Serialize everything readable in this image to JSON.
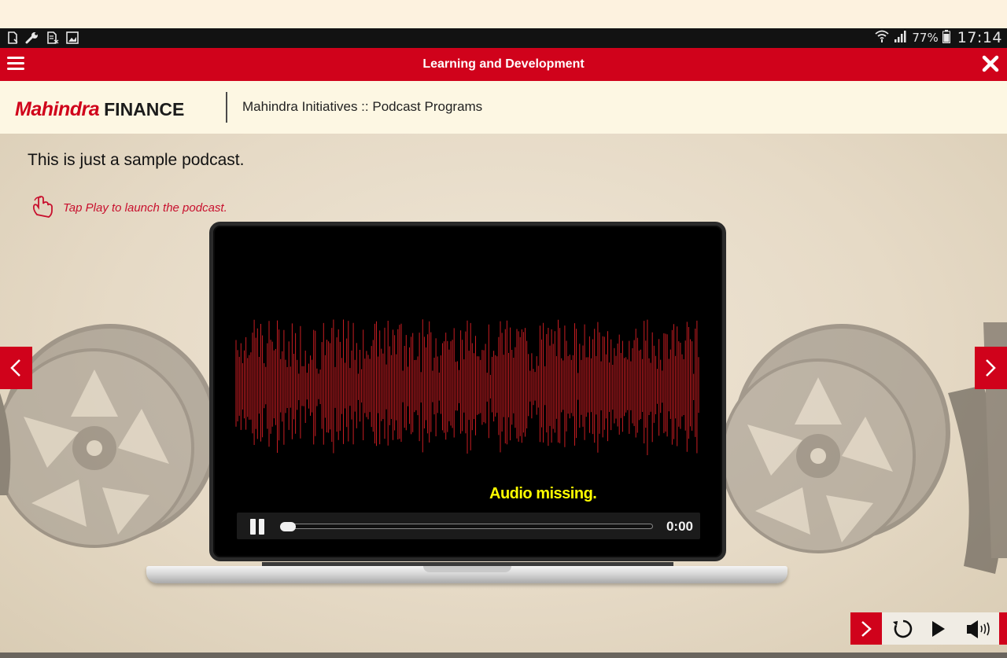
{
  "status_bar": {
    "left_icons": [
      "sim-card-icon",
      "wrench-icon",
      "sd-card-icon",
      "image-icon"
    ],
    "right_icons": [
      "wifi-icon",
      "signal-icon",
      "battery-icon"
    ],
    "battery_percent": "77%",
    "time": "17:14"
  },
  "title_bar": {
    "title": "Learning and Development",
    "menu_icon": "hamburger-menu-icon",
    "close_icon": "close-icon",
    "accent_color": "#d0021b"
  },
  "header": {
    "brand_primary": "Mahindra",
    "brand_secondary": "FINANCE",
    "breadcrumb": "Mahindra Initiatives :: Podcast Programs"
  },
  "content": {
    "intro": "This is just a sample podcast.",
    "hint": "Tap Play to launch the podcast.",
    "hint_icon": "tap-hand-icon",
    "subtitle": "Audio missing.",
    "player": {
      "state_icon": "pause-icon",
      "time": "0:00",
      "progress": 0.0
    }
  },
  "navigation": {
    "prev_icon": "chevron-left-icon",
    "next_icon": "chevron-right-icon"
  },
  "toolbar": {
    "icons": [
      "chevron-right-icon",
      "replay-icon",
      "play-icon",
      "volume-icon"
    ]
  }
}
